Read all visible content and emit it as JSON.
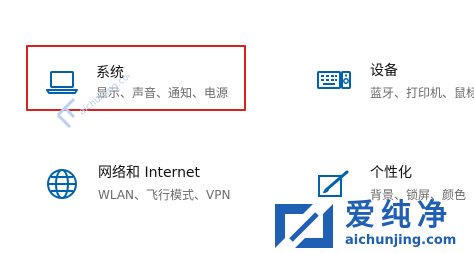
{
  "settings_tiles": [
    {
      "title": "系统",
      "description": "显示、声音、通知、电源",
      "icon": "laptop-icon",
      "highlighted": true
    },
    {
      "title": "设备",
      "description": "蓝牙、打印机、鼠标",
      "icon": "keyboard-icon",
      "highlighted": false
    },
    {
      "title": "网络和 Internet",
      "description": "WLAN、飞行模式、VPN",
      "icon": "globe-icon",
      "highlighted": false
    },
    {
      "title": "个性化",
      "description": "背景、锁屏、颜色",
      "icon": "paint-icon",
      "highlighted": false
    }
  ],
  "watermark": {
    "brand_name": "爱纯净",
    "url": "aichunjing.com",
    "diagonal_text": "aichunjing.com"
  },
  "colors": {
    "accent_icon": "#0063b1",
    "highlight_border": "#d9221c",
    "watermark_blue": "#1f5fb4"
  }
}
